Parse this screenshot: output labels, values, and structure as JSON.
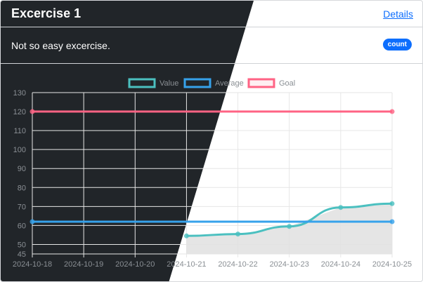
{
  "card": {
    "title": "Excercise 1",
    "details_label": "Details",
    "description": "Not so easy excercise.",
    "badge_label": "count"
  },
  "colors": {
    "value": "#4bc0c0",
    "average": "#36a2eb",
    "goal": "#ff6384",
    "fill": "#e0e0e0",
    "dark_bg": "#212529",
    "link": "#0d6efd"
  },
  "chart_data": {
    "type": "line",
    "categories": [
      "2024-10-18",
      "2024-10-19",
      "2024-10-20",
      "2024-10-21",
      "2024-10-22",
      "2024-10-23",
      "2024-10-24",
      "2024-10-25"
    ],
    "ylim": [
      45,
      130
    ],
    "yticks": [
      45,
      50,
      60,
      70,
      80,
      90,
      100,
      110,
      120,
      130
    ],
    "grid": true,
    "legend_position": "top",
    "series": [
      {
        "name": "Value",
        "values": [
          null,
          null,
          null,
          54.5,
          55.5,
          59.5,
          69.5,
          71.5
        ],
        "fill": true
      },
      {
        "name": "Average",
        "values": [
          62,
          62,
          62,
          62,
          62,
          62,
          62,
          62
        ]
      },
      {
        "name": "Goal",
        "values": [
          120,
          120,
          120,
          120,
          120,
          120,
          120,
          120
        ]
      }
    ]
  }
}
